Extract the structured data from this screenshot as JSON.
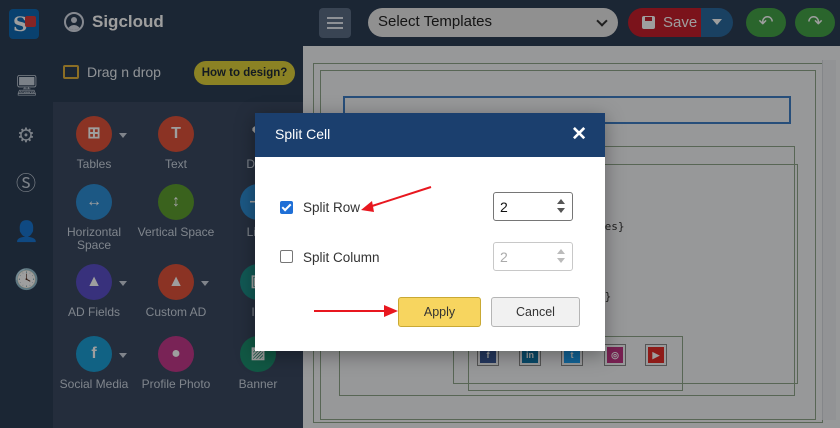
{
  "app": {
    "brand": "Sigcloud",
    "logo_letter": "S"
  },
  "toolbar": {
    "template_select": "Select Templates",
    "save_label": "Save",
    "undo_glyph": "↶",
    "redo_glyph": "↷"
  },
  "panel": {
    "title": "Drag n drop",
    "how_to": "How to design?",
    "widgets": [
      {
        "label": "Tables",
        "glyph": "⊞",
        "color": "#e0533a",
        "has_caret": true
      },
      {
        "label": "Text",
        "glyph": "T",
        "color": "#e0533a",
        "has_caret": false
      },
      {
        "label": "Disc",
        "glyph": "✎",
        "color": "#3a4a61",
        "has_caret": false
      },
      {
        "label": "Horizontal Space",
        "glyph": "↔",
        "color": "#2e8fd6",
        "has_caret": false
      },
      {
        "label": "Vertical Space",
        "glyph": "↕",
        "color": "#5e9e2f",
        "has_caret": false
      },
      {
        "label": "Line",
        "glyph": "—",
        "color": "#2e8fd6",
        "has_caret": false
      },
      {
        "label": "AD Fields",
        "glyph": "▲",
        "color": "#5b4fc8",
        "has_caret": true
      },
      {
        "label": "Custom AD",
        "glyph": "▲",
        "color": "#e0533a",
        "has_caret": true
      },
      {
        "label": "Im",
        "glyph": "▣",
        "color": "#1c8f88",
        "has_caret": false
      },
      {
        "label": "Social Media",
        "glyph": "f",
        "color": "#1c9ed6",
        "has_caret": true
      },
      {
        "label": "Profile Photo",
        "glyph": "●",
        "color": "#c3398c",
        "has_caret": false
      },
      {
        "label": "Banner",
        "glyph": "▨",
        "color": "#1c8f6e",
        "has_caret": false
      }
    ]
  },
  "canvas": {
    "cell_fragments": [
      "}",
      "mes}",
      "}}"
    ],
    "social_icons": [
      {
        "glyph": "f",
        "color": "#3b5998"
      },
      {
        "glyph": "in",
        "color": "#0e76a8"
      },
      {
        "glyph": "t",
        "color": "#1da1f2"
      },
      {
        "glyph": "◎",
        "color": "#c13584"
      },
      {
        "glyph": "▶",
        "color": "#e52d27"
      }
    ]
  },
  "dialog": {
    "title": "Split Cell",
    "close_glyph": "✕",
    "split_row": {
      "label": "Split Row",
      "checked": true,
      "value": "2"
    },
    "split_column": {
      "label": "Split Column",
      "checked": false,
      "value": "2"
    },
    "apply_label": "Apply",
    "cancel_label": "Cancel"
  },
  "colors": {
    "header_navy": "#1b3f6e",
    "apply_yellow": "#f7d55f",
    "save_red": "#c71f2c",
    "arrow_red": "#e8171f"
  }
}
